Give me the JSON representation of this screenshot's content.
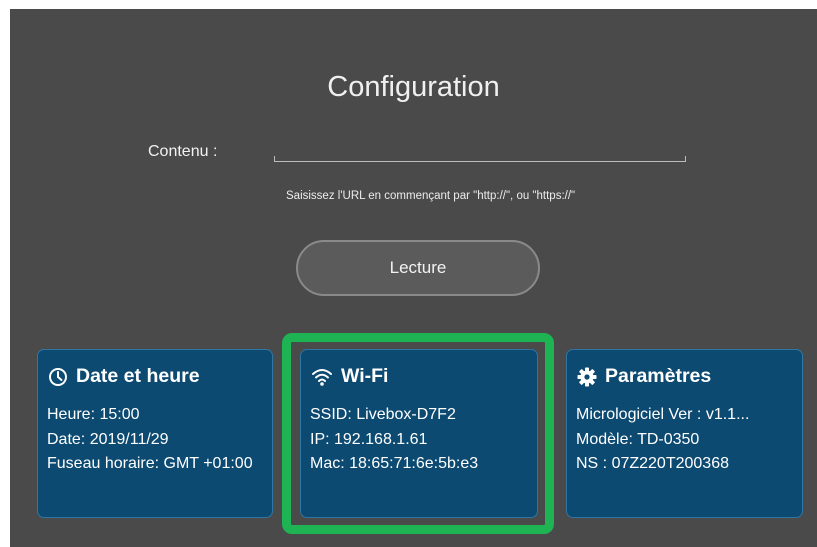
{
  "page": {
    "title": "Configuration",
    "content_label": "Contenu :",
    "url_value": "",
    "hint": "Saisissez l'URL en commençant par \"http://\", ou \"https://\"",
    "read_button": "Lecture"
  },
  "cards": {
    "datetime": {
      "icon": "clock-icon",
      "title": "Date et heure",
      "time": "Heure: 15:00",
      "date": "Date: 2019/11/29",
      "timezone": "Fuseau horaire: GMT +01:00"
    },
    "wifi": {
      "icon": "wifi-icon",
      "title": "Wi-Fi",
      "ssid": "SSID: Livebox-D7F2",
      "ip": "IP: 192.168.1.61",
      "mac": "Mac: 18:65:71:6e:5b:e3"
    },
    "settings": {
      "icon": "gear-icon",
      "title": "Paramètres",
      "firmware": "Micrologiciel Ver : v1.1...",
      "model": "Modèle: TD-0350",
      "serial": "NS : 07Z220T200368"
    }
  },
  "colors": {
    "screen_bg": "#4a4a4a",
    "card_bg": "#0c4a72",
    "card_border": "#2f76a3",
    "highlight": "#1eb353"
  }
}
